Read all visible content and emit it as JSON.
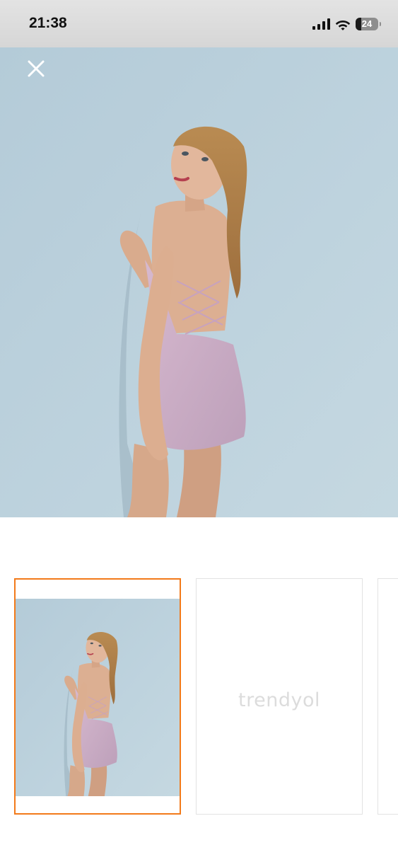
{
  "status_bar": {
    "time": "21:38",
    "battery_level": "24",
    "battery_fraction": 0.24,
    "icons": [
      "cellular-signal-icon",
      "wifi-icon",
      "battery-icon"
    ]
  },
  "viewer": {
    "close_icon": "close-icon",
    "main_image": "product-photo-model-in-pink-glitter-dress"
  },
  "thumbnails": {
    "selected_index": 0,
    "items": [
      {
        "kind": "photo",
        "image": "product-photo-model-in-pink-glitter-dress"
      },
      {
        "kind": "placeholder",
        "placeholder_text": "trendyol"
      },
      {
        "kind": "placeholder",
        "placeholder_text": ""
      }
    ]
  },
  "colors": {
    "selected_border": "#f27a1a",
    "thumb_border": "#e2e2e2",
    "backdrop": "#b9d0dc"
  }
}
